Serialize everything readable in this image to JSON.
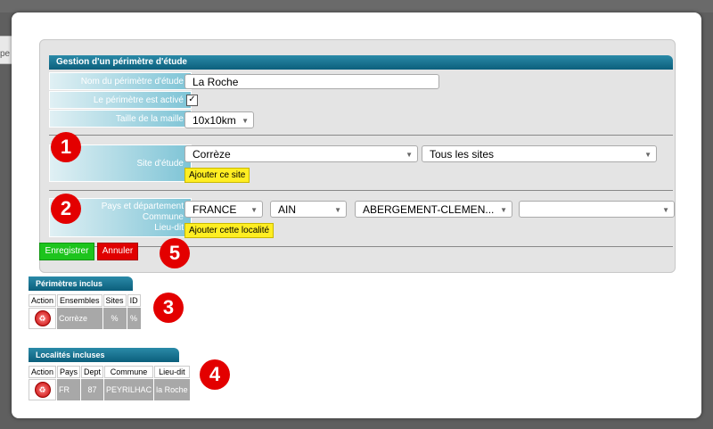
{
  "background": {
    "left_tab_text": "pe"
  },
  "panel": {
    "title": "Gestion d'un périmètre d'étude",
    "name_label": "Nom du périmètre d'étude",
    "name_value": "La Roche",
    "active_label": "Le périmètre est activé",
    "active_checked": "✓",
    "mesh_label": "Taille de la maille",
    "mesh_value": "10x10km"
  },
  "site": {
    "label": "Site d'étude",
    "dept_select": "Corrèze",
    "sites_select": "Tous les sites",
    "add_button": "Ajouter ce site"
  },
  "locality": {
    "label_line1": "Pays et département",
    "label_line2": "Commune",
    "label_line3": "Lieu-dit",
    "country_select": "FRANCE",
    "dept_select": "AIN",
    "commune_select": "ABERGEMENT-CLEMEN...",
    "lieudit_select": "",
    "add_button": "Ajouter cette localité"
  },
  "actions": {
    "save": "Enregistrer",
    "cancel": "Annuler"
  },
  "badges": [
    "1",
    "2",
    "3",
    "4",
    "5"
  ],
  "perimetres": {
    "title": "Périmètres inclus",
    "headers": [
      "Action",
      "Ensembles",
      "Sites",
      "ID"
    ],
    "rows": [
      {
        "ensembles": "Corrèze",
        "sites": "%",
        "id": "%"
      }
    ]
  },
  "localites": {
    "title": "Localités incluses",
    "headers": [
      "Action",
      "Pays",
      "Dept",
      "Commune",
      "Lieu-dit"
    ],
    "rows": [
      {
        "pays": "FR",
        "dept": "87",
        "commune": "PEYRILHAC",
        "lieudit": "la Roche"
      }
    ]
  },
  "colors": {
    "header_blue": "#0c5f7c",
    "save_green": "#1dc41d",
    "cancel_red": "#e00000",
    "add_yellow": "#ffee22",
    "badge_red": "#e30000"
  }
}
